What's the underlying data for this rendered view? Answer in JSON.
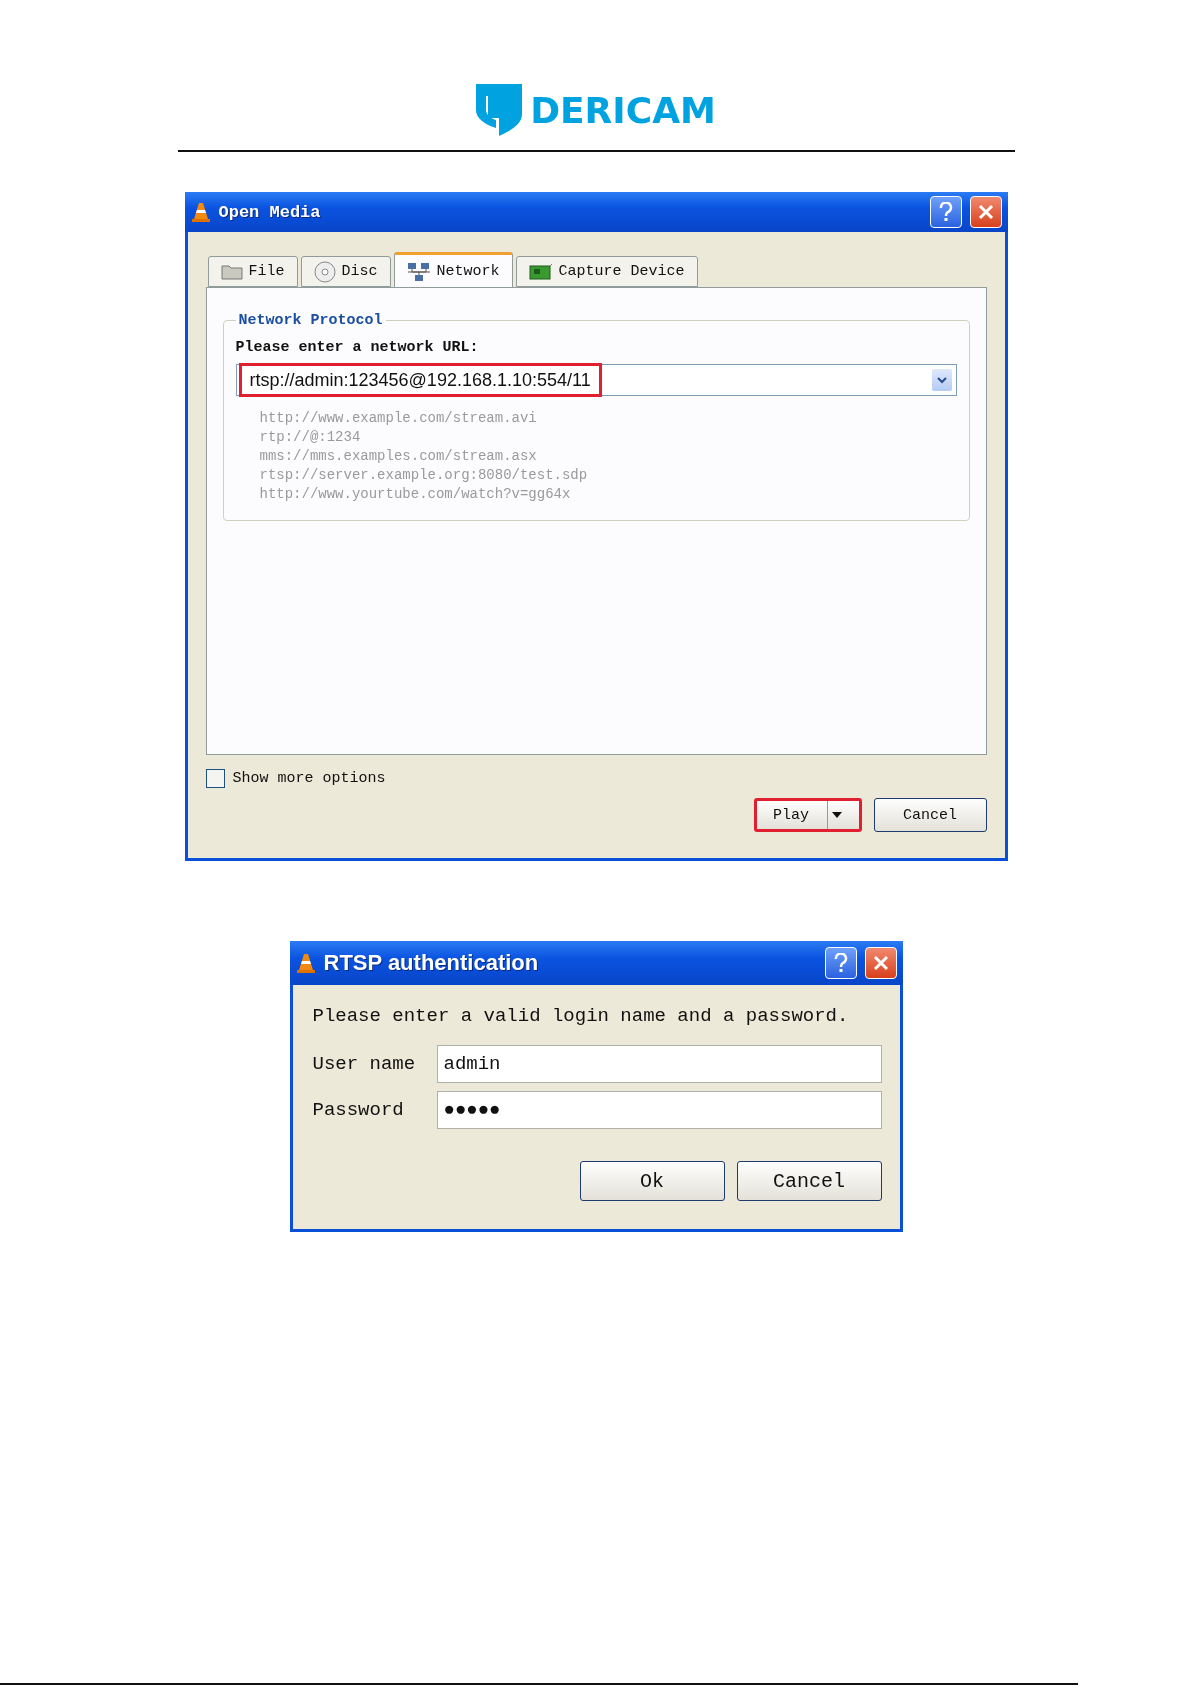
{
  "header": {
    "logo_text": "DERICAM"
  },
  "open_media": {
    "title": "Open Media",
    "tabs": [
      {
        "label": "File",
        "selected": false
      },
      {
        "label": "Disc",
        "selected": false
      },
      {
        "label": "Network",
        "selected": true
      },
      {
        "label": "Capture Device",
        "selected": false
      }
    ],
    "group_title": "Network Protocol",
    "url_label": "Please enter a network URL:",
    "url_value": "rtsp://admin:123456@192.168.1.10:554/11",
    "url_highlighted": true,
    "examples": [
      "http://www.example.com/stream.avi",
      "rtp://@:1234",
      "mms://mms.examples.com/stream.asx",
      "rtsp://server.example.org:8080/test.sdp",
      "http://www.yourtube.com/watch?v=gg64x"
    ],
    "show_more_options": {
      "label": "Show more options",
      "checked": false
    },
    "buttons": [
      {
        "label": "Play",
        "kind": "split",
        "highlighted": true
      },
      {
        "label": "Cancel",
        "kind": "plain",
        "highlighted": false
      }
    ]
  },
  "rtsp_auth": {
    "title": "RTSP authentication",
    "message": "Please enter a valid login name and a password.",
    "fields": [
      {
        "label": "User name",
        "value": "admin"
      },
      {
        "label": "Password",
        "value": "●●●●●"
      }
    ],
    "buttons": [
      {
        "label": "Ok"
      },
      {
        "label": "Cancel"
      }
    ]
  }
}
